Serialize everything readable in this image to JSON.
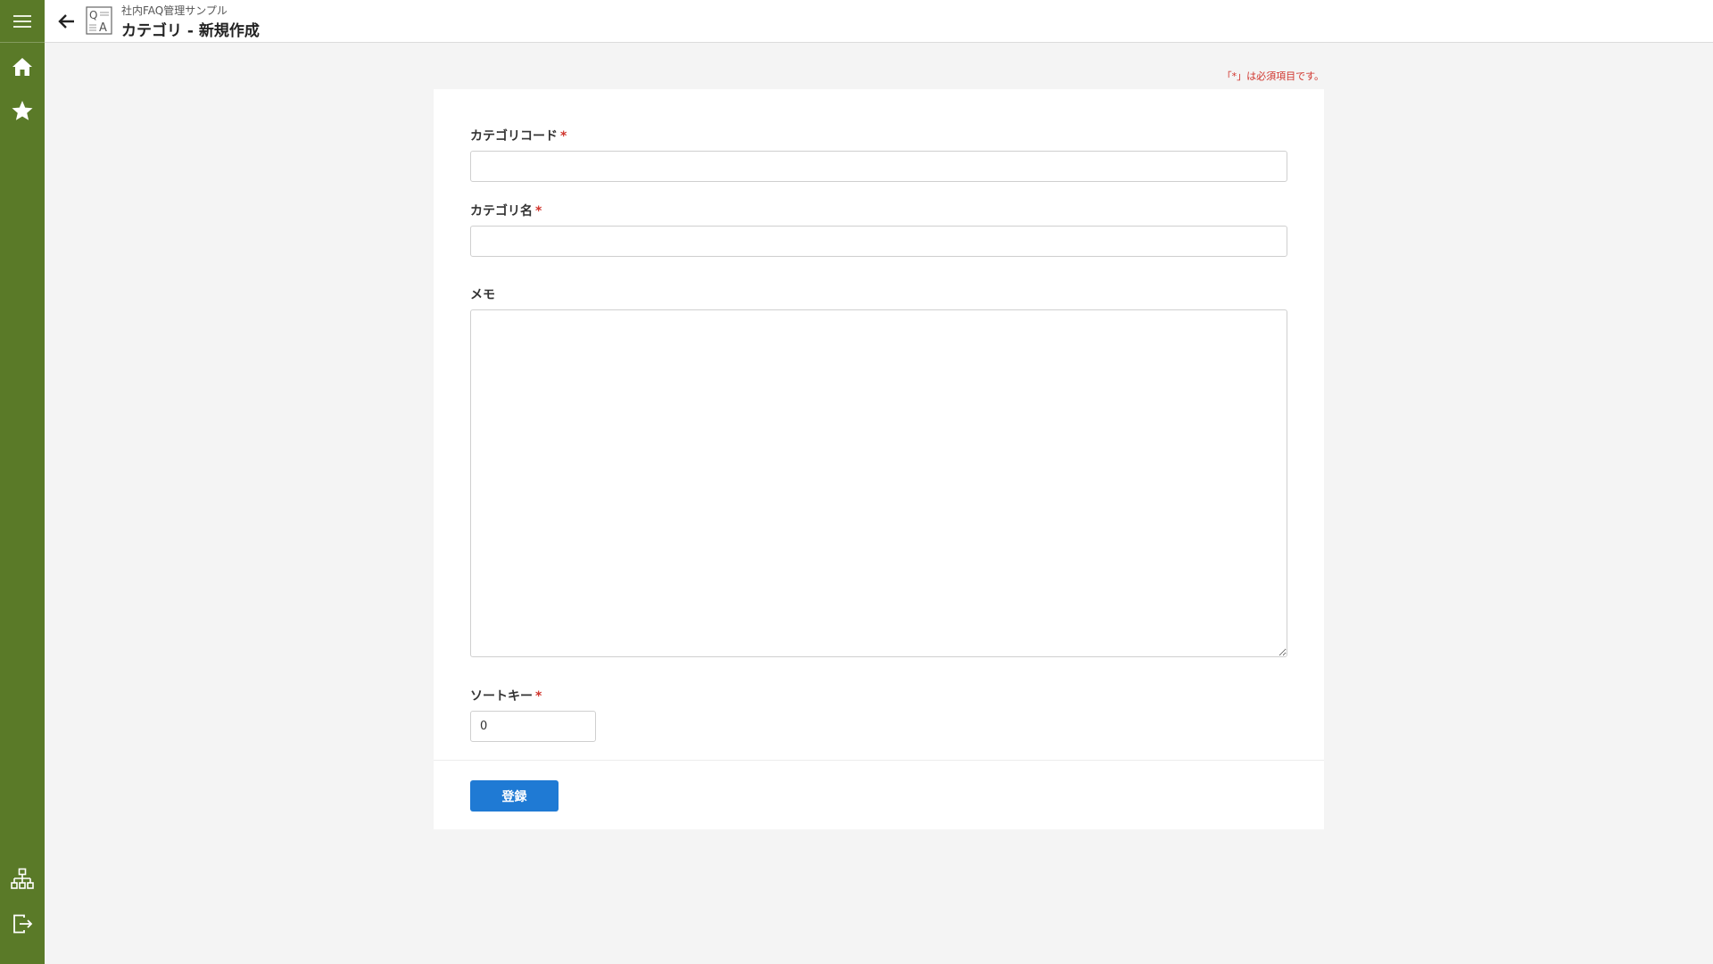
{
  "header": {
    "app_name": "社内FAQ管理サンプル",
    "page_title": "カテゴリ - 新規作成"
  },
  "form": {
    "required_note": "「*」は必須項目です。",
    "required_mark": "*",
    "fields": {
      "category_code": {
        "label": "カテゴリコード",
        "value": ""
      },
      "category_name": {
        "label": "カテゴリ名",
        "value": ""
      },
      "memo": {
        "label": "メモ",
        "value": ""
      },
      "sort_key": {
        "label": "ソートキー",
        "value": "0"
      }
    },
    "submit_label": "登録"
  },
  "sidebar": {
    "icons": [
      "menu-icon",
      "home-icon",
      "star-icon",
      "sitemap-icon",
      "logout-icon"
    ]
  },
  "colors": {
    "sidebar": "#5a7a28",
    "accent": "#1f7ad4",
    "required": "#d0342c"
  }
}
